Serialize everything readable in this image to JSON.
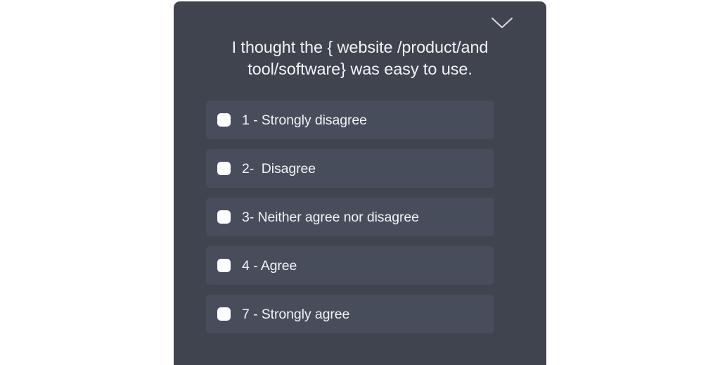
{
  "survey": {
    "question": "I thought the { website /product/and\ntool/software} was easy to use.",
    "collapse_icon": "chevron-down-icon",
    "options": [
      {
        "label": "1 - Strongly disagree",
        "checked": false
      },
      {
        "label": "2-  Disagree",
        "checked": false
      },
      {
        "label": "3- Neither agree nor disagree",
        "checked": false
      },
      {
        "label": "4 - Agree",
        "checked": false
      },
      {
        "label": "7 - Strongly agree",
        "checked": false
      }
    ]
  },
  "colors": {
    "page_background": "#ffffff",
    "card_background": "#40444f",
    "option_background": "#484d5c",
    "text": "#f2f3f5",
    "checkbox_fill": "#ffffff"
  }
}
